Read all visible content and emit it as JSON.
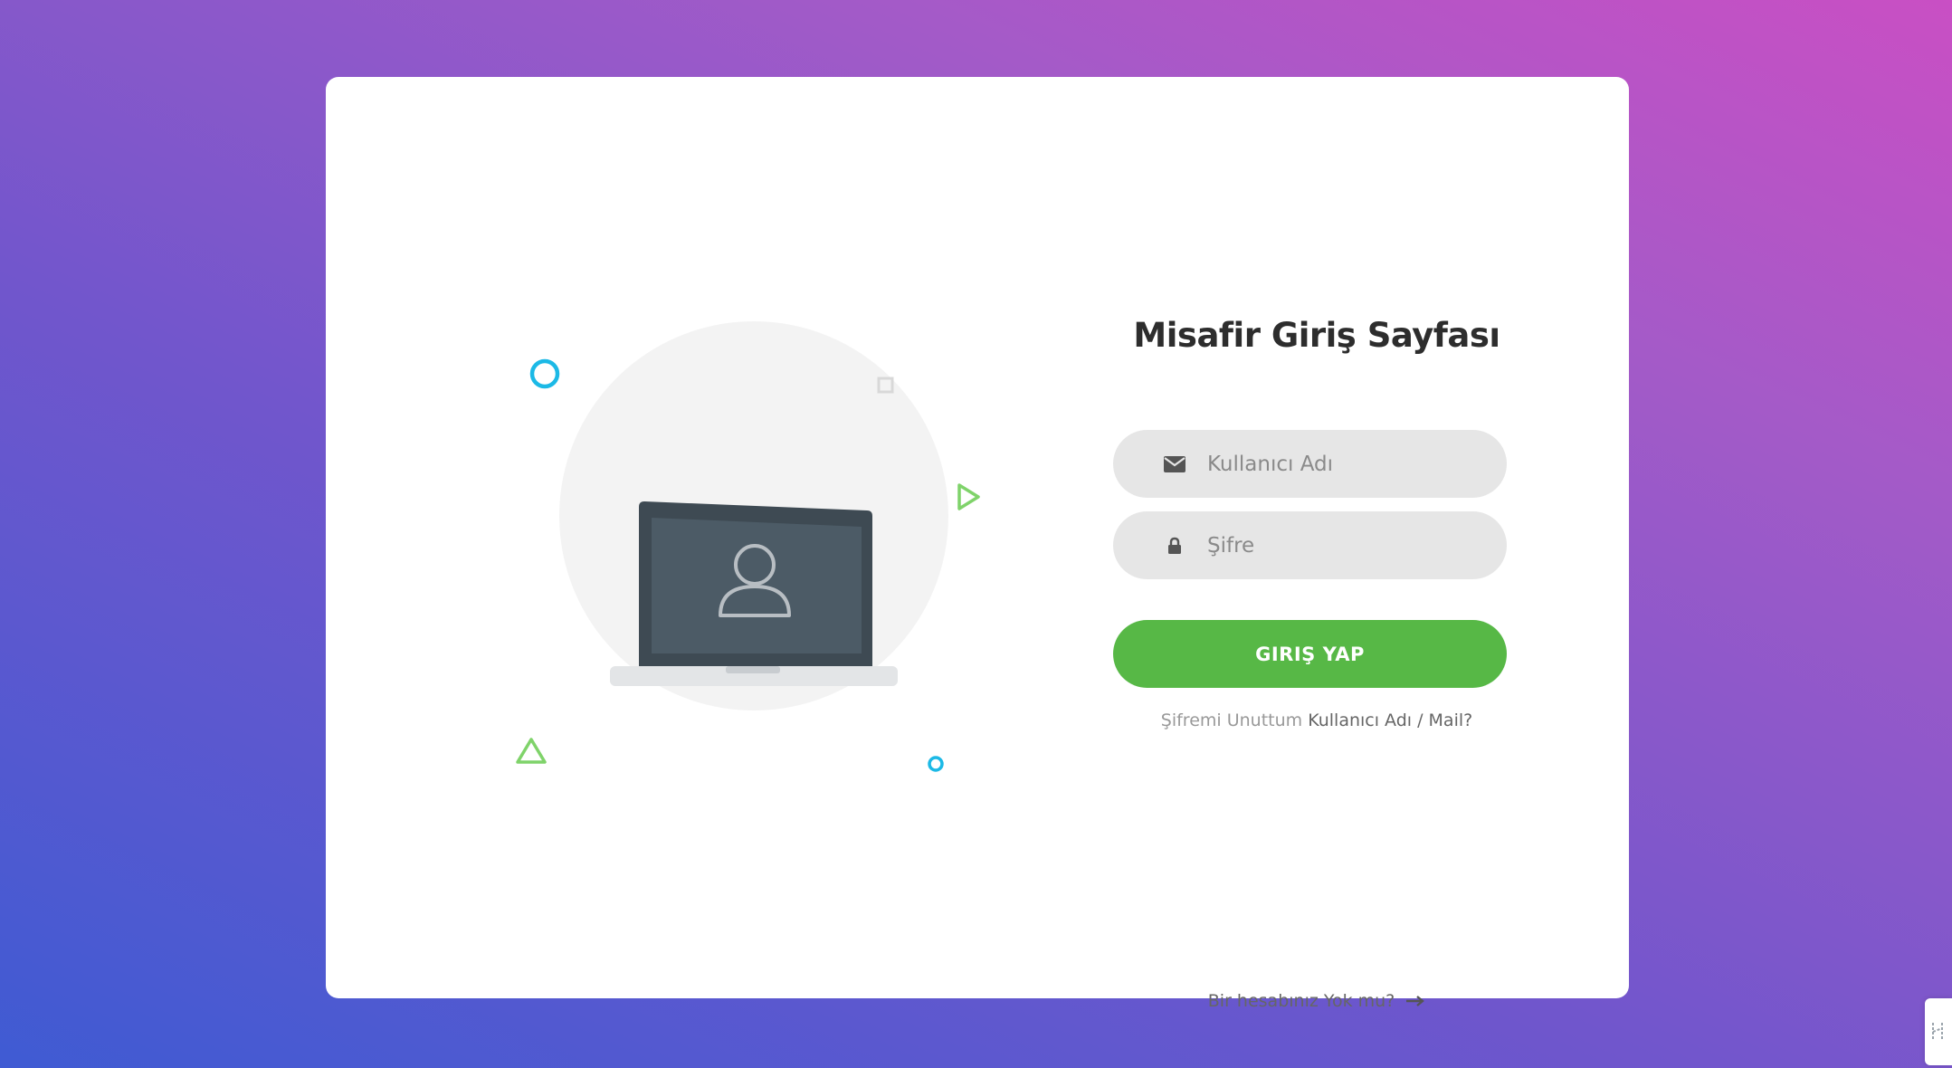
{
  "page": {
    "title": "Misafir Giriş Sayfası"
  },
  "form": {
    "username_placeholder": "Kullanıcı Adı",
    "username_value": "",
    "password_placeholder": "Şifre",
    "password_value": "",
    "submit_label": "GIRIŞ YAP",
    "forgot_prefix": "Şifremi Unuttum",
    "forgot_link": "Kullanıcı Adı / Mail?",
    "signup_label": "Bir hesabınız Yok mu?"
  },
  "icons": {
    "username": "envelope-icon",
    "password": "lock-icon",
    "signup_arrow": "arrow-right-icon",
    "illustration": "laptop-user-icon"
  },
  "colors": {
    "accent_green": "#57b846",
    "field_bg": "#e6e6e6",
    "shape_blue": "#1cb9e6",
    "shape_green": "#7fd36a"
  }
}
